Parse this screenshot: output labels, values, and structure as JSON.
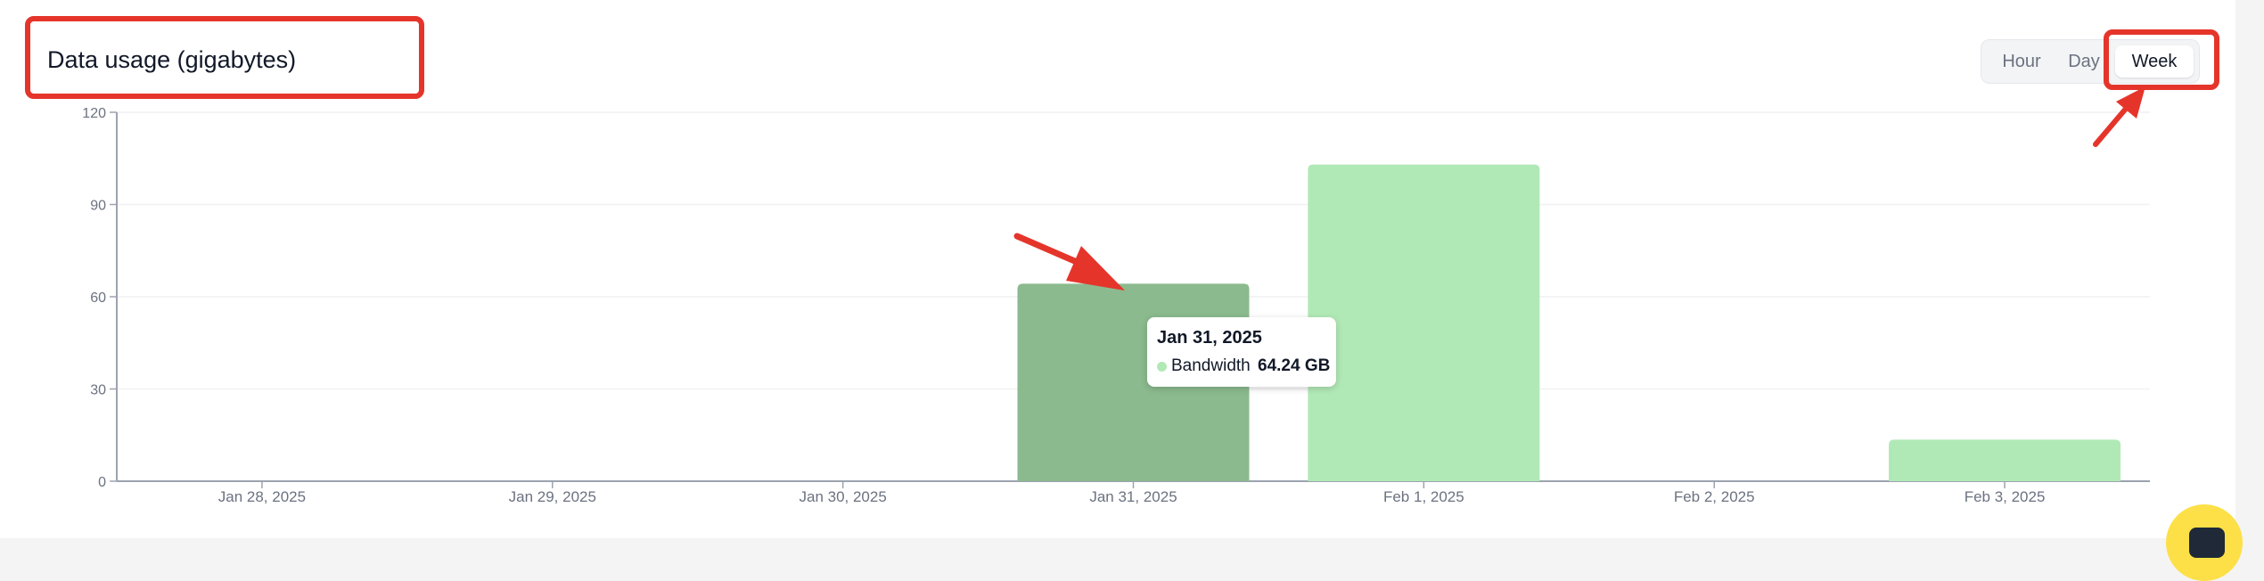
{
  "card": {
    "title": "Data usage (gigabytes)"
  },
  "range_toggle": {
    "options": [
      "Hour",
      "Day",
      "Week"
    ],
    "selected": "Week"
  },
  "tooltip": {
    "date": "Jan 31, 2025",
    "series": "Bandwidth",
    "value": "64.24 GB"
  },
  "colors": {
    "bar": "#b1e9b6",
    "bar_highlight": "#8bba8e",
    "annotation": "#e5352b",
    "axis": "#9ca3af",
    "grid": "#f1f1f3"
  },
  "icons": {
    "chat_button": "chat-icon"
  },
  "chart_data": {
    "type": "bar",
    "title": "Data usage (gigabytes)",
    "categories": [
      "Jan 28, 2025",
      "Jan 29, 2025",
      "Jan 30, 2025",
      "Jan 31, 2025",
      "Feb 1, 2025",
      "Feb 2, 2025",
      "Feb 3, 2025"
    ],
    "series": [
      {
        "name": "Bandwidth",
        "values": [
          0,
          0,
          0,
          64.24,
          103,
          0,
          13.5
        ]
      }
    ],
    "ylim": [
      0,
      120
    ],
    "yticks": [
      0,
      30,
      60,
      90,
      120
    ],
    "grid": true,
    "highlighted_category": "Jan 31, 2025"
  }
}
